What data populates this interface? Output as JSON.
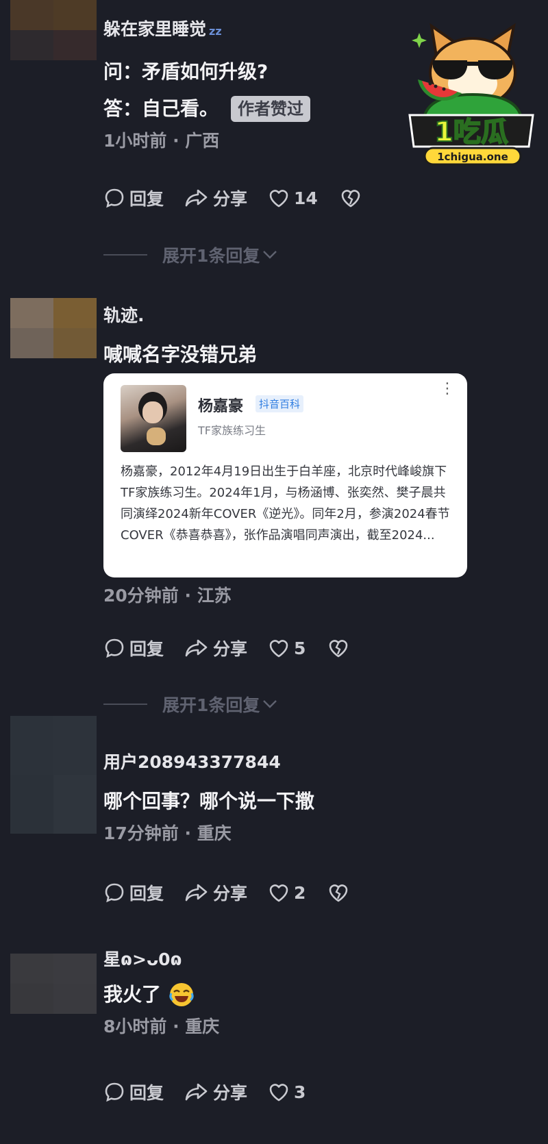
{
  "comments": [
    {
      "username": "躲在家里睡觉",
      "username_suffix": "zz",
      "line1": "问：矛盾如何升级?",
      "line2": "答：自己看。",
      "badge": "作者赞过",
      "meta": "1小时前 · 广西",
      "reply_label": "回复",
      "share_label": "分享",
      "likes": "14",
      "expand_label": "展开1条回复",
      "avatar_colors": [
        "#4a3828",
        "#4e3b26",
        "#2e2a2e",
        "#362a2c"
      ]
    },
    {
      "username": "轨迹.",
      "line1": "喊喊名字没错兄弟",
      "meta": "20分钟前 · 江苏",
      "reply_label": "回复",
      "share_label": "分享",
      "likes": "5",
      "expand_label": "展开1条回复",
      "avatar_colors": [
        "#7d6d5e",
        "#7a5e33",
        "#6f6359",
        "#725a36"
      ],
      "card": {
        "name": "杨嘉豪",
        "tag": "抖音百科",
        "subtitle": "TF家族练习生",
        "description": "杨嘉豪，2012年4月19日出生于白羊座，北京时代峰峻旗下TF家族练习生。2024年1月，与杨涵博、张奕然、樊子晨共同演绎2024新年COVER《逆光》。同年2月，参演2024春节COVER《恭喜恭喜》，张作品演唱同声演出，截至2024..."
      }
    },
    {
      "username": "用户208943377844",
      "line1": "哪个回事？哪个说一下撒",
      "meta": "17分钟前 · 重庆",
      "reply_label": "回复",
      "share_label": "分享",
      "likes": "2",
      "avatar_colors": [
        "#2c323a",
        "#2d333b",
        "#2b3139",
        "#2f353d"
      ]
    },
    {
      "username": "星ɷ>ᴗ0ɷ",
      "line1": "我火了",
      "meta": "8小时前 · 重庆",
      "reply_label": "回复",
      "share_label": "分享",
      "likes": "3",
      "avatar_colors": [
        "#3a3a3e",
        "#3b3b40",
        "#38383c",
        "#3a3a3f"
      ]
    }
  ],
  "sticker": {
    "brand": "1吃瓜",
    "url": "1chigua.one"
  },
  "colors": {
    "background": "#1c1e27",
    "badge_bg": "#c8c9cf",
    "meta_text": "#9a9ba4",
    "card_tag": "#2f7de1"
  }
}
